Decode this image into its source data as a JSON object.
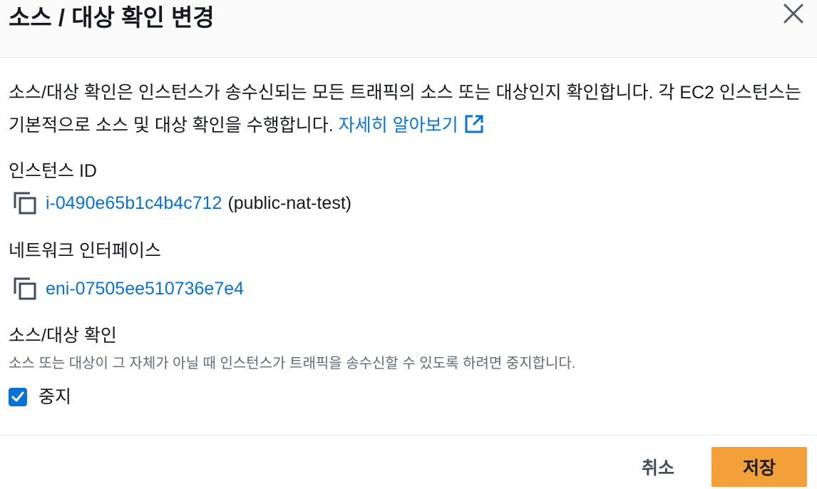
{
  "dialog": {
    "title": "소스 / 대상 확인 변경"
  },
  "description": {
    "text": "소스/대상 확인은 인스턴스가 송수신되는 모든 트래픽의 소스 또는 대상인지 확인합니다. 각 EC2 인스턴스는 기본적으로 소스 및 대상 확인을 수행합니다.",
    "learn_more_link": "자세히 알아보기"
  },
  "instance": {
    "label": "인스턴스 ID",
    "id": "i-0490e65b1c4b4c712",
    "name": "(public-nat-test)"
  },
  "network_interface": {
    "label": "네트워크 인터페이스",
    "id": "eni-07505ee510736e7e4"
  },
  "source_dest_check": {
    "label": "소스/대상 확인",
    "description": "소스 또는 대상이 그 자체가 아닐 때 인스턴스가 트래픽을 송수신할 수 있도록 하려면 중지합니다.",
    "checkbox_label": "중지",
    "checked": true
  },
  "footer": {
    "cancel_label": "취소",
    "save_label": "저장"
  },
  "colors": {
    "link": "#0972d3",
    "primary_button": "#f3a03b",
    "checkbox": "#0972d3"
  },
  "icons": {
    "close": "close-icon",
    "external_link": "external-link-icon",
    "copy": "copy-icon",
    "check": "checkmark-icon"
  }
}
